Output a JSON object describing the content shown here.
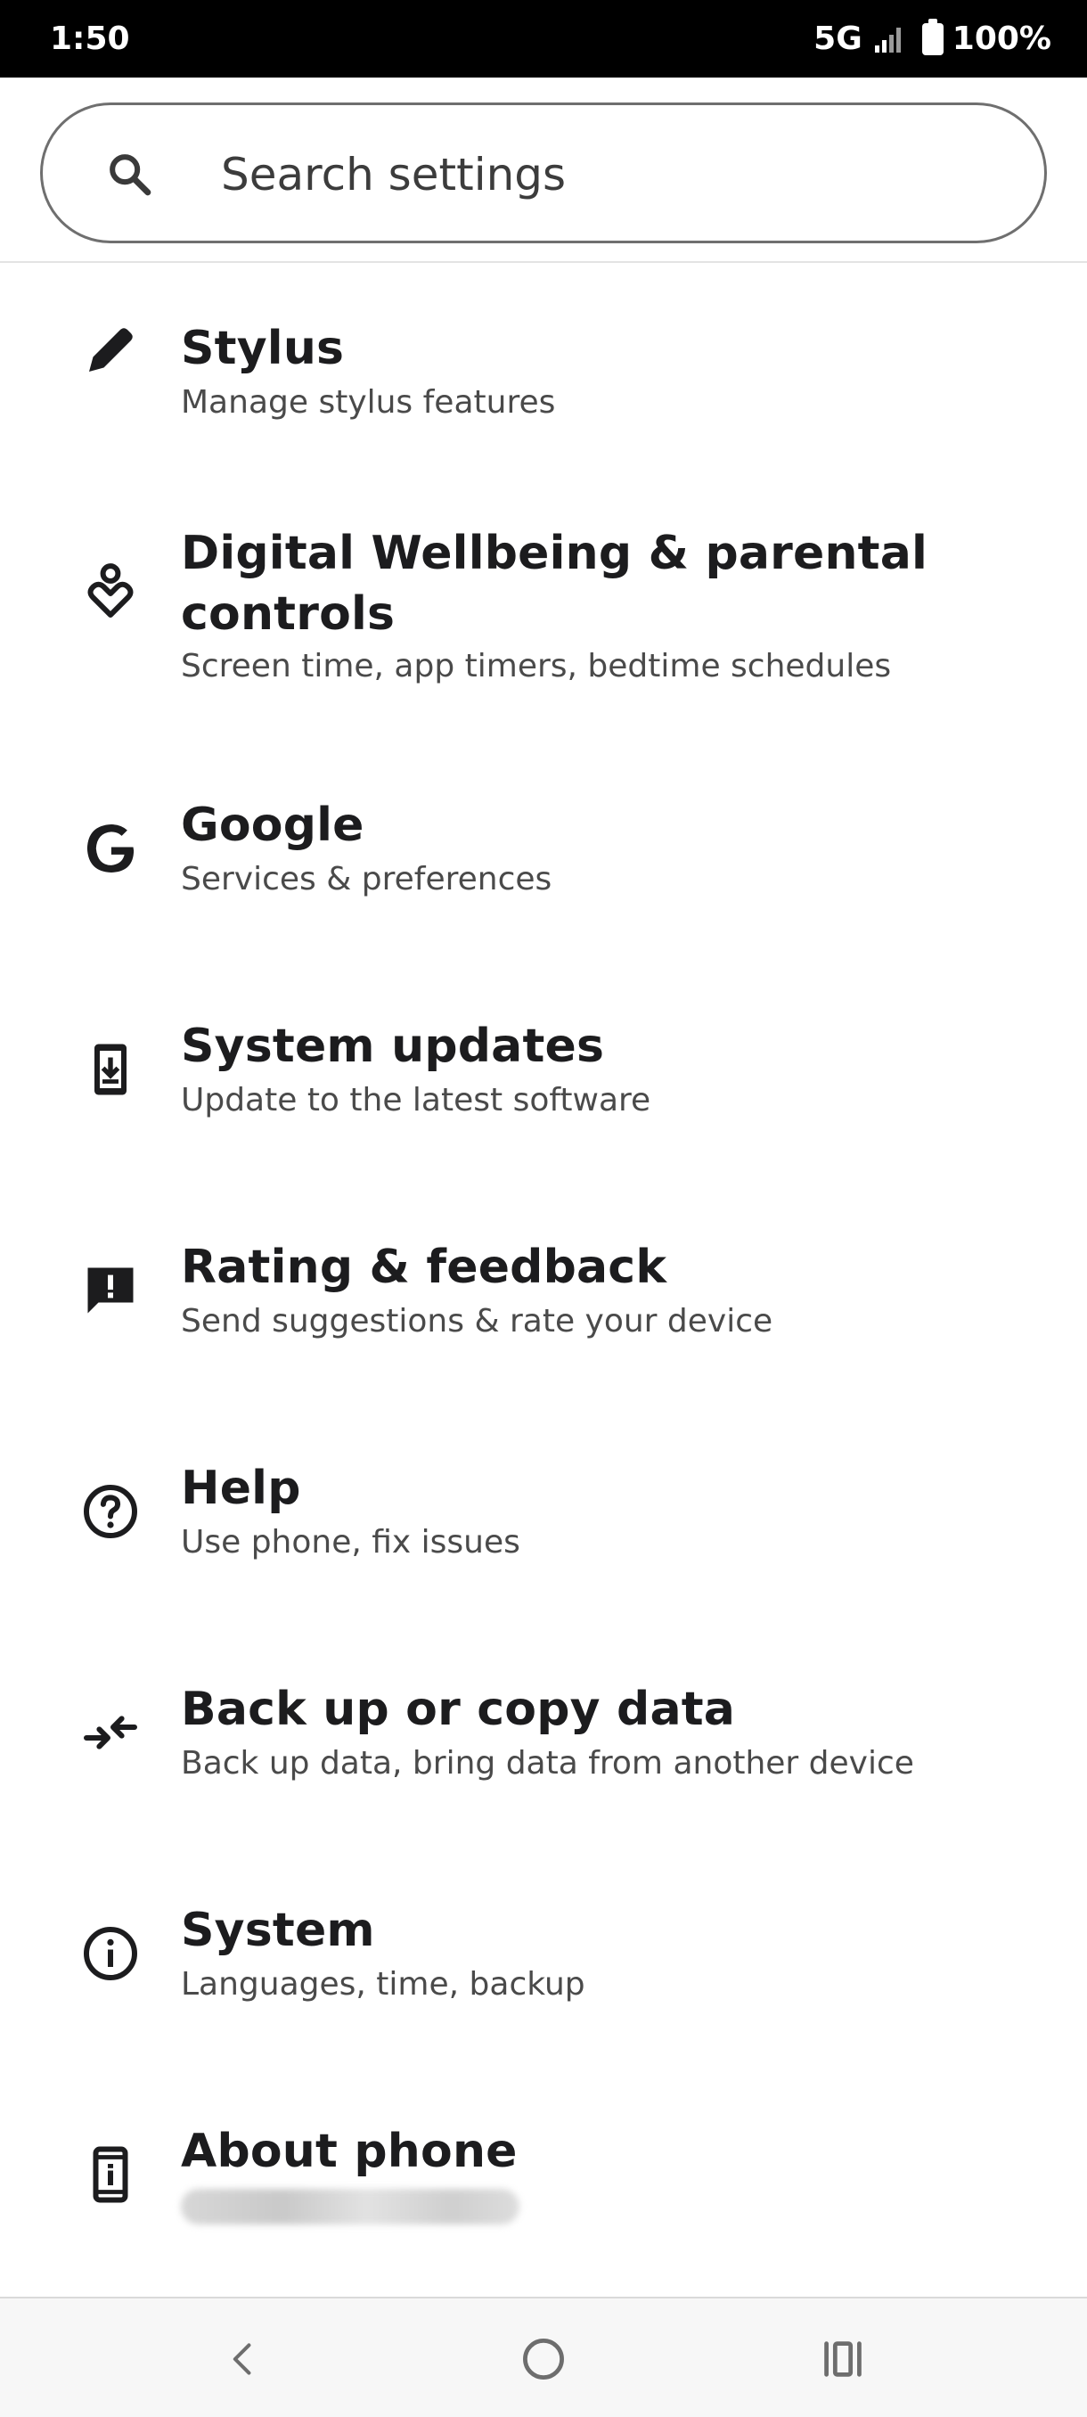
{
  "status_bar": {
    "time": "1:50",
    "network": "5G",
    "battery": "100%"
  },
  "search": {
    "placeholder": "Search settings"
  },
  "settings": [
    {
      "icon": "stylus-icon",
      "title": "Stylus",
      "subtitle": "Manage stylus features"
    },
    {
      "icon": "digital-wellbeing-icon",
      "title": "Digital Wellbeing & parental controls",
      "subtitle": "Screen time, app timers, bedtime schedules"
    },
    {
      "icon": "google-icon",
      "title": "Google",
      "subtitle": "Services & preferences"
    },
    {
      "icon": "system-update-icon",
      "title": "System updates",
      "subtitle": "Update to the latest software"
    },
    {
      "icon": "feedback-icon",
      "title": "Rating & feedback",
      "subtitle": "Send suggestions & rate your device"
    },
    {
      "icon": "help-icon",
      "title": "Help",
      "subtitle": "Use phone, fix issues"
    },
    {
      "icon": "backup-copy-icon",
      "title": "Back up or copy data",
      "subtitle": "Back up data, bring data from another device"
    },
    {
      "icon": "info-icon",
      "title": "System",
      "subtitle": "Languages, time, backup"
    },
    {
      "icon": "about-phone-icon",
      "title": "About phone",
      "subtitle": ""
    }
  ],
  "colors": {
    "status_bar": "#000000",
    "text_primary": "#1c1c1e",
    "text_secondary": "#4a4a4a",
    "nav_bar": "#f7f7f7"
  }
}
